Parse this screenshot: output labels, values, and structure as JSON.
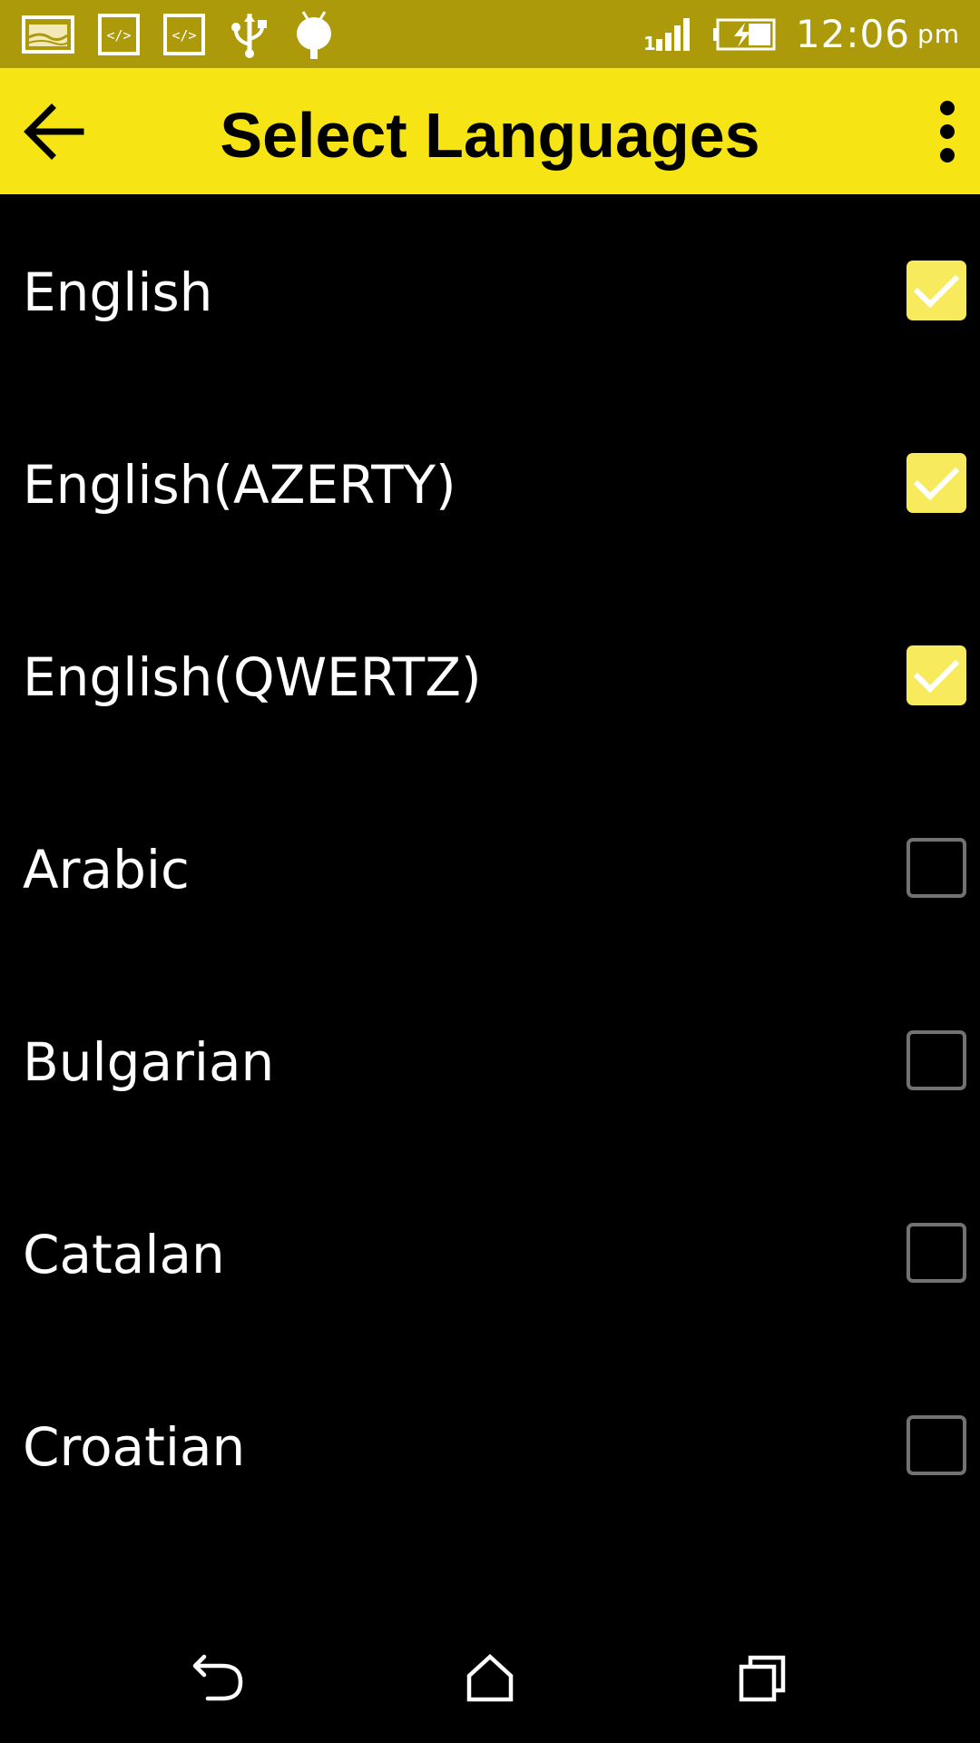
{
  "status_bar": {
    "icons_left": [
      "image-notification-icon",
      "code-notification-icon",
      "code-notification-icon",
      "usb-icon",
      "android-debug-icon"
    ],
    "icons_right": [
      "signal-icon",
      "battery-charging-icon"
    ],
    "time": "12:06",
    "ampm": "pm",
    "background_color": "#ac9a0a"
  },
  "app_bar": {
    "title": "Select Languages",
    "back_icon": "arrow-back-icon",
    "menu_icon": "more-vert-icon",
    "background_color": "#f7e414"
  },
  "languages": [
    {
      "label": "English",
      "checked": true
    },
    {
      "label": "English(AZERTY)",
      "checked": true
    },
    {
      "label": "English(QWERTZ)",
      "checked": true
    },
    {
      "label": "Arabic",
      "checked": false
    },
    {
      "label": "Bulgarian",
      "checked": false
    },
    {
      "label": "Catalan",
      "checked": false
    },
    {
      "label": "Croatian",
      "checked": false
    }
  ],
  "colors": {
    "checkbox_checked": "#f7ea5c",
    "checkbox_unchecked_border": "#727272",
    "list_background": "#000000",
    "text": "#ffffff"
  },
  "nav_bar": {
    "buttons": [
      "nav-back-icon",
      "nav-home-icon",
      "nav-recents-icon"
    ]
  }
}
